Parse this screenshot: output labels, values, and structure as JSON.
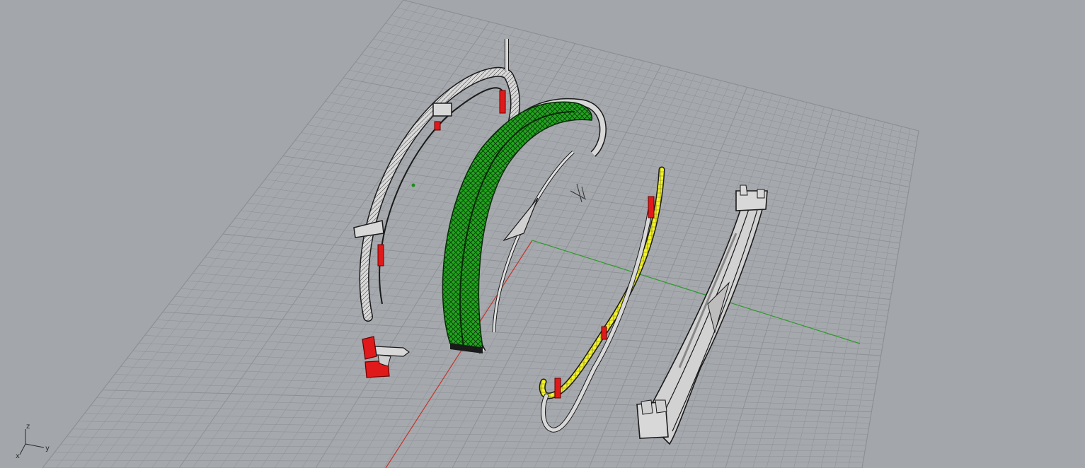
{
  "viewport": {
    "view": "Perspective",
    "background_color": "#a3a6aa",
    "grid_line_color": "#8c8f93",
    "x_axis_color": "#c0362c",
    "y_axis_color": "#2f9a2f"
  },
  "axis_widget": {
    "z_label": "z",
    "y_label": "y",
    "x_label": "x"
  },
  "objects": [
    {
      "name": "upper-arch-frame",
      "color": "#d9d9d9",
      "state": "unselected"
    },
    {
      "name": "green-arch-band",
      "color": "#22a51e",
      "state": "highlighted"
    },
    {
      "name": "yellow-selected-rail",
      "color": "#f2f22a",
      "state": "selected"
    },
    {
      "name": "right-arch-ring",
      "color": "#d9d9d9",
      "state": "unselected"
    },
    {
      "name": "red-bracket-parts",
      "color": "#e01a1a",
      "state": "highlighted"
    }
  ]
}
